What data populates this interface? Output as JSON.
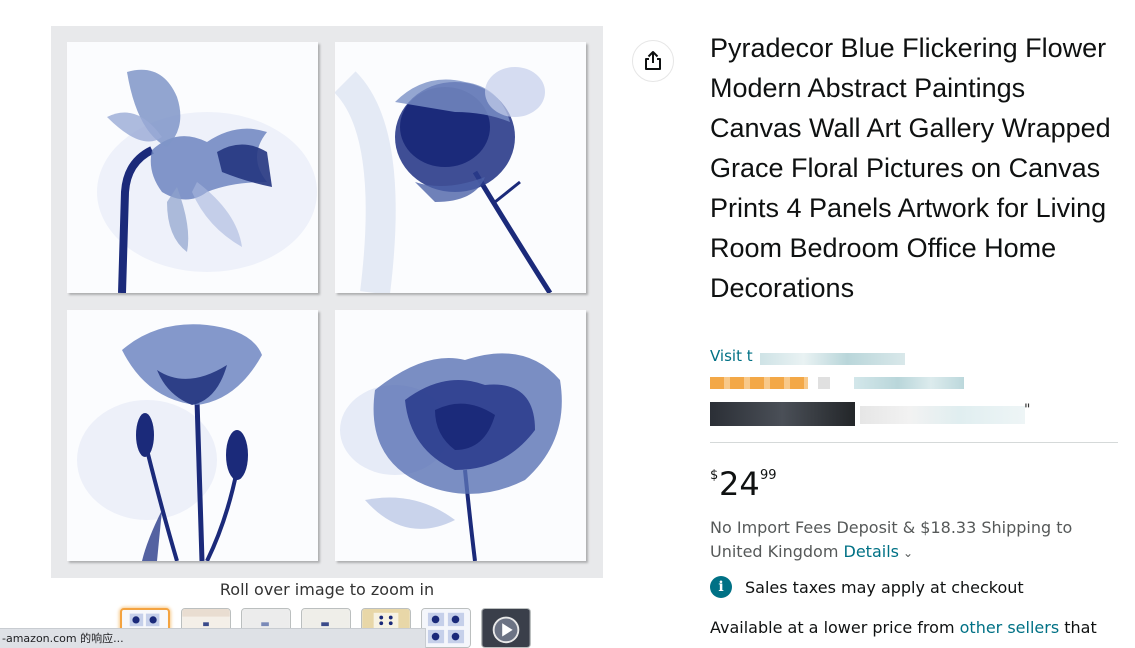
{
  "product": {
    "title": "Pyradecor Blue Flickering Flower Modern Abstract Paintings Canvas Wall Art Gallery Wrapped Grace Floral Pictures on Canvas Prints 4 Panels Artwork for Living Room Bedroom Office Home Decorations",
    "store_link_visible": "Visit t",
    "stray_quote": "\""
  },
  "gallery": {
    "zoom_hint": "Roll over image to zoom in",
    "thumbnails": [
      "thumb-1",
      "thumb-2",
      "thumb-3",
      "thumb-4",
      "thumb-5",
      "thumb-6",
      "thumb-video"
    ]
  },
  "price": {
    "symbol": "$",
    "whole": "24",
    "fraction": "99"
  },
  "shipping": {
    "text": "No Import Fees Deposit & $18.33 Shipping to United Kingdom ",
    "details_link": "Details",
    "chevron": "⌄"
  },
  "tax": {
    "icon_glyph": "i",
    "text": "Sales taxes may apply at checkout"
  },
  "other_sellers": {
    "prefix": "Available at a lower price from ",
    "link": "other sellers",
    "suffix": " that"
  },
  "status_bar": {
    "text": "-amazon.com 的响应..."
  },
  "colors": {
    "link": "#007185",
    "flower_dark": "#1b2a7a",
    "flower_light": "#8fa3cc",
    "thumb_selected": "#f4a340"
  }
}
